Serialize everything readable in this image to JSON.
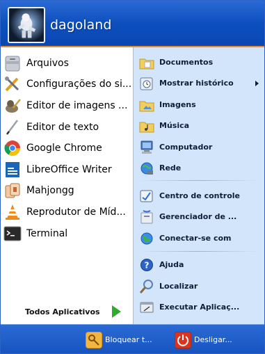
{
  "user": {
    "name": "dagoland"
  },
  "apps": [
    {
      "label": "Arquivos",
      "icon": "file-manager-icon"
    },
    {
      "label": "Configurações do si...",
      "icon": "settings-tools-icon"
    },
    {
      "label": "Editor de imagens ...",
      "icon": "image-editor-icon"
    },
    {
      "label": "Editor de texto",
      "icon": "text-editor-icon"
    },
    {
      "label": "Google Chrome",
      "icon": "chrome-icon"
    },
    {
      "label": "LibreOffice Writer",
      "icon": "writer-icon"
    },
    {
      "label": "Mahjongg",
      "icon": "mahjongg-icon"
    },
    {
      "label": "Reprodutor de Míd...",
      "icon": "vlc-cone-icon"
    },
    {
      "label": "Terminal",
      "icon": "terminal-icon"
    }
  ],
  "all_apps_label": "Todos Aplicativos",
  "places": [
    {
      "label": "Documentos",
      "icon": "documents-folder-icon"
    },
    {
      "label": "Mostrar histórico",
      "icon": "history-icon",
      "submenu": true
    },
    {
      "label": "Imagens",
      "icon": "pictures-folder-icon"
    },
    {
      "label": "Música",
      "icon": "music-folder-icon"
    },
    {
      "label": "Computador",
      "icon": "computer-icon"
    },
    {
      "label": "Rede",
      "icon": "network-icon"
    },
    {
      "label": "Centro de controle",
      "icon": "control-center-icon"
    },
    {
      "label": "Gerenciador de ...",
      "icon": "manager-icon"
    },
    {
      "label": "Conectar-se com",
      "icon": "connect-globe-icon"
    },
    {
      "label": "Ajuda",
      "icon": "help-icon"
    },
    {
      "label": "Localizar",
      "icon": "search-icon"
    },
    {
      "label": "Executar Aplicaç...",
      "icon": "run-app-icon"
    }
  ],
  "footer": {
    "lock_label": "Bloquear t...",
    "shutdown_label": "Desligar..."
  },
  "colors": {
    "header": "#0d4fbe",
    "accent_line": "#e88a2d",
    "right_panel": "#d3e5fa",
    "all_apps_arrow": "#31a82e",
    "shutdown": "#d9351e"
  }
}
